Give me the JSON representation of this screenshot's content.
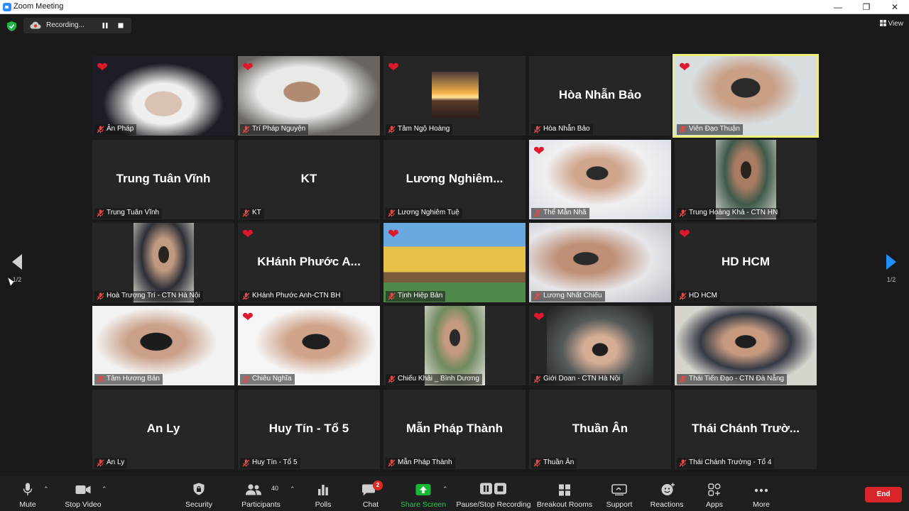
{
  "window": {
    "title": "Zoom Meeting"
  },
  "recording": {
    "label": "Recording..."
  },
  "view": {
    "label": "View"
  },
  "pager": {
    "current": "1/2"
  },
  "participants": [
    {
      "name": "Ân Pháp",
      "display": "",
      "video": true,
      "heart": true,
      "active": false
    },
    {
      "name": "Trí Pháp Nguyện",
      "display": "",
      "video": true,
      "heart": true,
      "active": false
    },
    {
      "name": "Tâm Ngộ Hoàng",
      "display": "",
      "video": true,
      "heart": true,
      "active": false
    },
    {
      "name": "Hòa Nhẫn Bảo",
      "display": "Hòa Nhẫn Bảo",
      "video": false,
      "heart": false,
      "active": false
    },
    {
      "name": "Viên Đạo Thuận",
      "display": "",
      "video": true,
      "heart": true,
      "active": true
    },
    {
      "name": "Trung Tuân Vĩnh",
      "display": "Trung Tuân Vĩnh",
      "video": false,
      "heart": false,
      "active": false
    },
    {
      "name": "KT",
      "display": "KT",
      "video": false,
      "heart": false,
      "active": false
    },
    {
      "name": "Lương Nghiêm Tuệ",
      "display": "Lương  Nghiêm...",
      "video": false,
      "heart": false,
      "active": false
    },
    {
      "name": "Thể Mẫn Nhã",
      "display": "",
      "video": true,
      "heart": true,
      "active": false
    },
    {
      "name": "Trung Hoàng Khả - CTN HN",
      "display": "",
      "video": true,
      "heart": false,
      "active": false
    },
    {
      "name": "Hoà Trượng Trí - CTN Hà Nội",
      "display": "",
      "video": true,
      "heart": false,
      "active": false
    },
    {
      "name": "KHánh Phước Anh-CTN BH",
      "display": "KHánh  Phước  A...",
      "video": false,
      "heart": true,
      "active": false
    },
    {
      "name": "Tịnh Hiệp Bản",
      "display": "",
      "video": true,
      "heart": true,
      "active": false
    },
    {
      "name": "Lương Nhất Chiếu",
      "display": "",
      "video": true,
      "heart": false,
      "active": false
    },
    {
      "name": "HD HCM",
      "display": "HD HCM",
      "video": false,
      "heart": true,
      "active": false
    },
    {
      "name": "Tâm Hương Bản",
      "display": "",
      "video": true,
      "heart": false,
      "active": false
    },
    {
      "name": "Chiêu Nghĩa",
      "display": "",
      "video": true,
      "heart": true,
      "active": false
    },
    {
      "name": "Chiếu Khải _ Bình Dương",
      "display": "",
      "video": true,
      "heart": false,
      "active": false
    },
    {
      "name": "Giới Doan - CTN Hà Nội",
      "display": "",
      "video": true,
      "heart": true,
      "active": false
    },
    {
      "name": "Thái Tiến Đạo - CTN Đà Nẵng",
      "display": "",
      "video": true,
      "heart": false,
      "active": false
    },
    {
      "name": "An Ly",
      "display": "An Ly",
      "video": false,
      "heart": false,
      "active": false
    },
    {
      "name": "Huy Tín - Tổ 5",
      "display": "Huy Tín - Tổ 5",
      "video": false,
      "heart": false,
      "active": false
    },
    {
      "name": "Mẫn Pháp Thành",
      "display": "Mẫn Pháp Thành",
      "video": false,
      "heart": false,
      "active": false
    },
    {
      "name": "Thuần Ân",
      "display": "Thuần Ân",
      "video": false,
      "heart": false,
      "active": false
    },
    {
      "name": "Thái Chánh Trường - Tổ 4",
      "display": "Thái  Chánh  Trườ...",
      "video": false,
      "heart": false,
      "active": false
    }
  ],
  "toolbar": {
    "mute": "Mute",
    "stop_video": "Stop Video",
    "security": "Security",
    "participants": "Participants",
    "participants_count": "40",
    "polls": "Polls",
    "chat": "Chat",
    "chat_badge": "2",
    "share_screen": "Share Screen",
    "pause_stop_recording": "Pause/Stop Recording",
    "breakout_rooms": "Breakout Rooms",
    "support": "Support",
    "reactions": "Reactions",
    "apps": "Apps",
    "more": "More",
    "end": "End"
  },
  "colors": {
    "accent": "#2d8cff",
    "share_green": "#18b837",
    "end_red": "#d9252a",
    "active_speaker": "#e8f07a",
    "heart": "#e0182d"
  }
}
